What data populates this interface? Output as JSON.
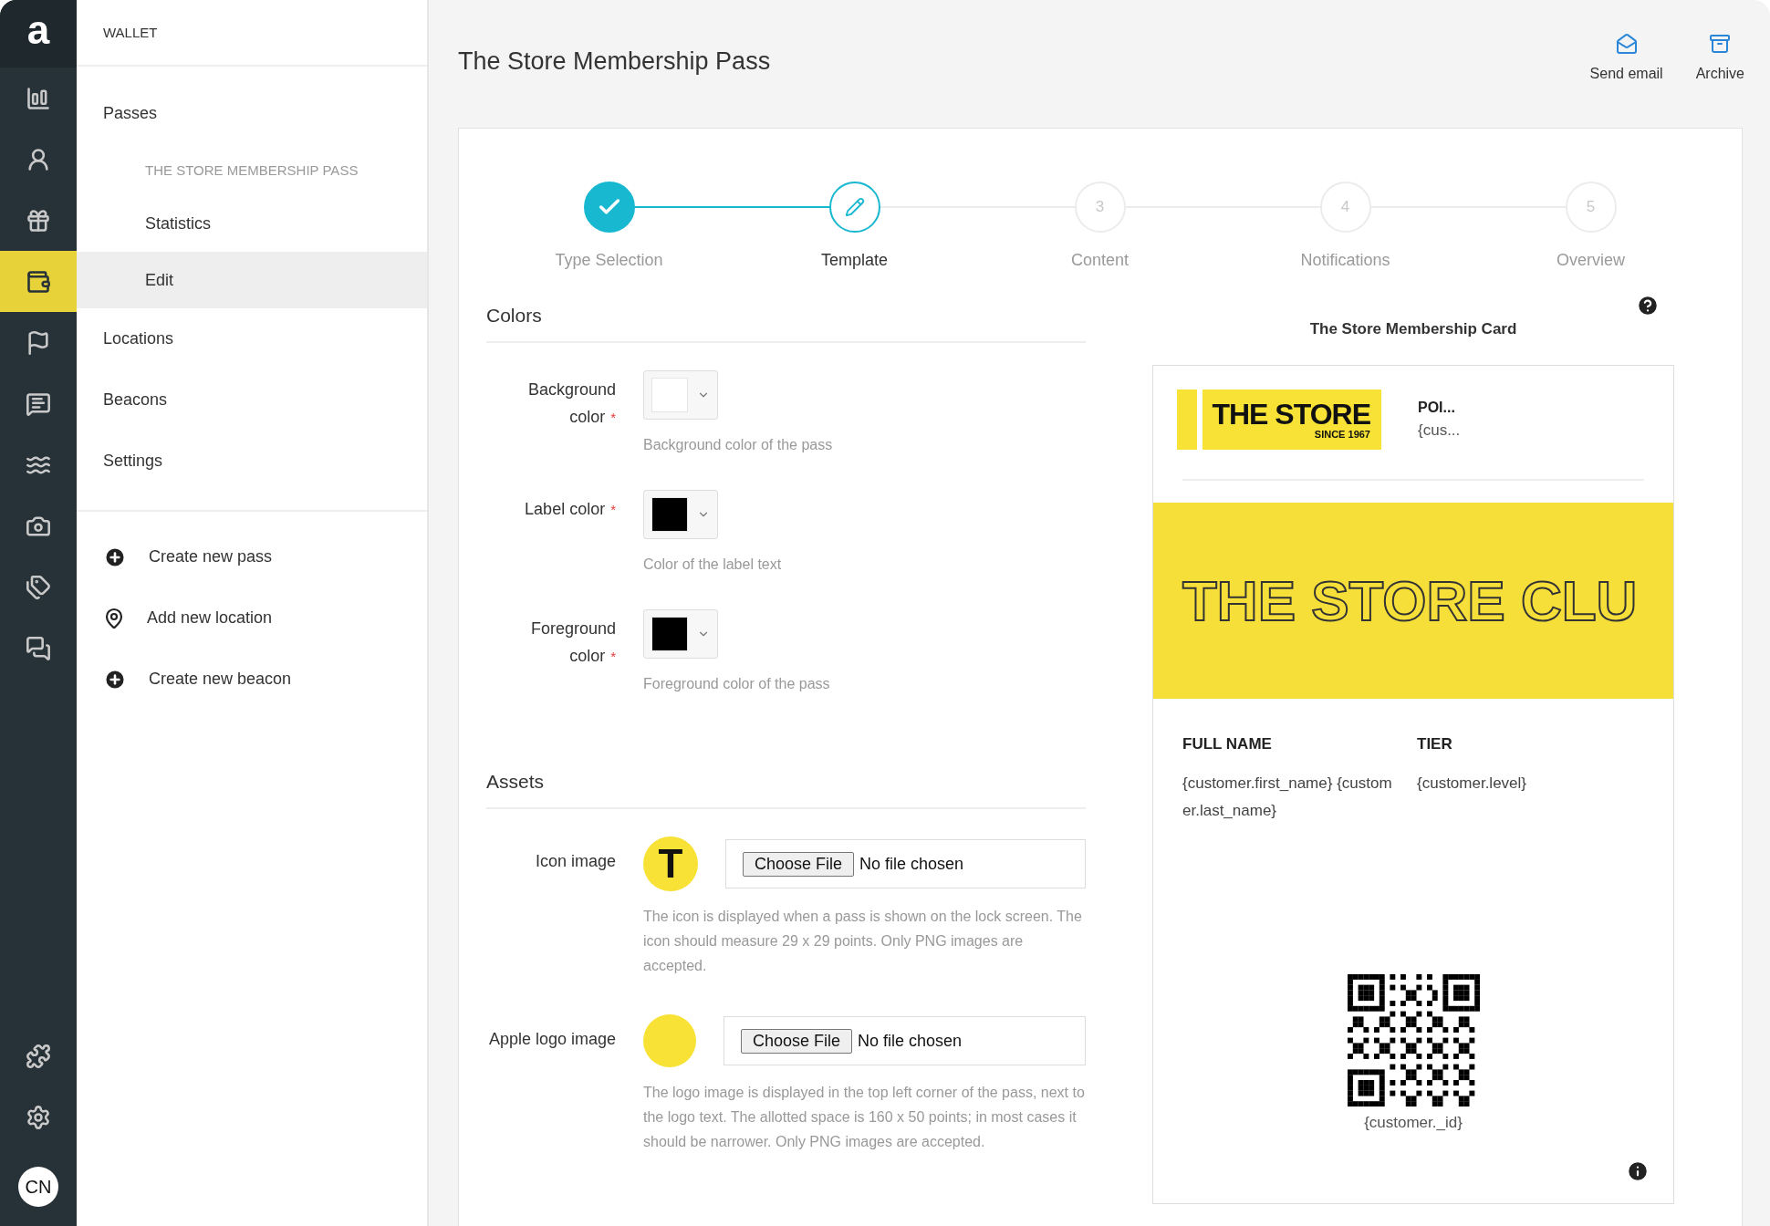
{
  "rail": {
    "logo": "a",
    "items": [
      {
        "kind": "chart",
        "selected": false
      },
      {
        "kind": "users",
        "selected": false
      },
      {
        "kind": "gift",
        "selected": false
      },
      {
        "kind": "wallet",
        "selected": true
      },
      {
        "kind": "flag",
        "selected": false
      },
      {
        "kind": "message",
        "selected": false
      },
      {
        "kind": "waves",
        "selected": false
      },
      {
        "kind": "camera",
        "selected": false
      },
      {
        "kind": "tags",
        "selected": false
      },
      {
        "kind": "chats",
        "selected": false
      }
    ],
    "bottom_items": [
      {
        "kind": "puzzle"
      },
      {
        "kind": "settings"
      }
    ],
    "avatar": "CN"
  },
  "sidebar": {
    "header": "WALLET",
    "nav": [
      {
        "label": "Passes",
        "selected": false,
        "children": [
          {
            "label": "THE STORE MEMBERSHIP PASS",
            "kind": "heading",
            "selected": false
          },
          {
            "label": "Statistics",
            "kind": "link",
            "selected": false
          },
          {
            "label": "Edit",
            "kind": "link",
            "selected": true
          }
        ]
      },
      {
        "label": "Locations",
        "selected": false
      },
      {
        "label": "Beacons",
        "selected": false
      },
      {
        "label": "Settings",
        "selected": false
      }
    ],
    "actions": [
      {
        "label": "Create new pass",
        "kind": "add"
      },
      {
        "label": "Add new location",
        "kind": "pin"
      },
      {
        "label": "Create new beacon",
        "kind": "add"
      }
    ]
  },
  "page": {
    "title": "The Store Membership Pass",
    "actions": [
      {
        "label": "Send email",
        "kind": "mail"
      },
      {
        "label": "Archive",
        "kind": "archive"
      }
    ]
  },
  "stepper": [
    {
      "label": "Type Selection",
      "completed": true,
      "selected": false
    },
    {
      "label": "Template",
      "completed": false,
      "selected": true
    },
    {
      "label": "Content",
      "number": "3",
      "completed": false,
      "selected": false
    },
    {
      "label": "Notifications",
      "number": "4",
      "completed": false,
      "selected": false
    },
    {
      "label": "Overview",
      "number": "5",
      "completed": false,
      "selected": false
    }
  ],
  "colors": {
    "title": "Colors",
    "fields": [
      {
        "label": "Background color",
        "required_mark": "*",
        "color": "#ffffff",
        "help": "Background color of the pass"
      },
      {
        "label": "Label color",
        "required_mark": "*",
        "color": "#000000",
        "help": "Color of the label text"
      },
      {
        "label": "Foreground color",
        "required_mark": "*",
        "color": "#000000",
        "help": "Foreground color of the pass"
      }
    ]
  },
  "assets": {
    "title": "Assets",
    "fields": [
      {
        "label": "Icon image",
        "kind": "icon",
        "thumbnail_text": "T",
        "button": "Choose File",
        "status": "No file chosen",
        "help": "The icon is displayed when a pass is shown on the lock screen. The icon should measure 29 x 29 points. Only PNG images are accepted."
      },
      {
        "label": "Apple logo image",
        "kind": "logo",
        "button": "Choose File",
        "status": "No file chosen",
        "help": "The logo image is displayed in the top left corner of the pass, next to the logo text. The allotted space is 160 x 50 points; in most cases it should be narrower. Only PNG images are accepted."
      }
    ]
  },
  "preview": {
    "title": "The Store Membership Card",
    "logo_text": "THE STORE",
    "logo_subtext": "SINCE 1967",
    "header_label": "POI...",
    "header_value": "{cus...",
    "strip_text": "THE STORE CLU",
    "fields": [
      {
        "label": "FULL NAME",
        "value": "{customer.first_name} {customer.last_name}"
      },
      {
        "label": "TIER",
        "value": "{customer.level}"
      }
    ],
    "barcode_text": "{customer._id}"
  }
}
